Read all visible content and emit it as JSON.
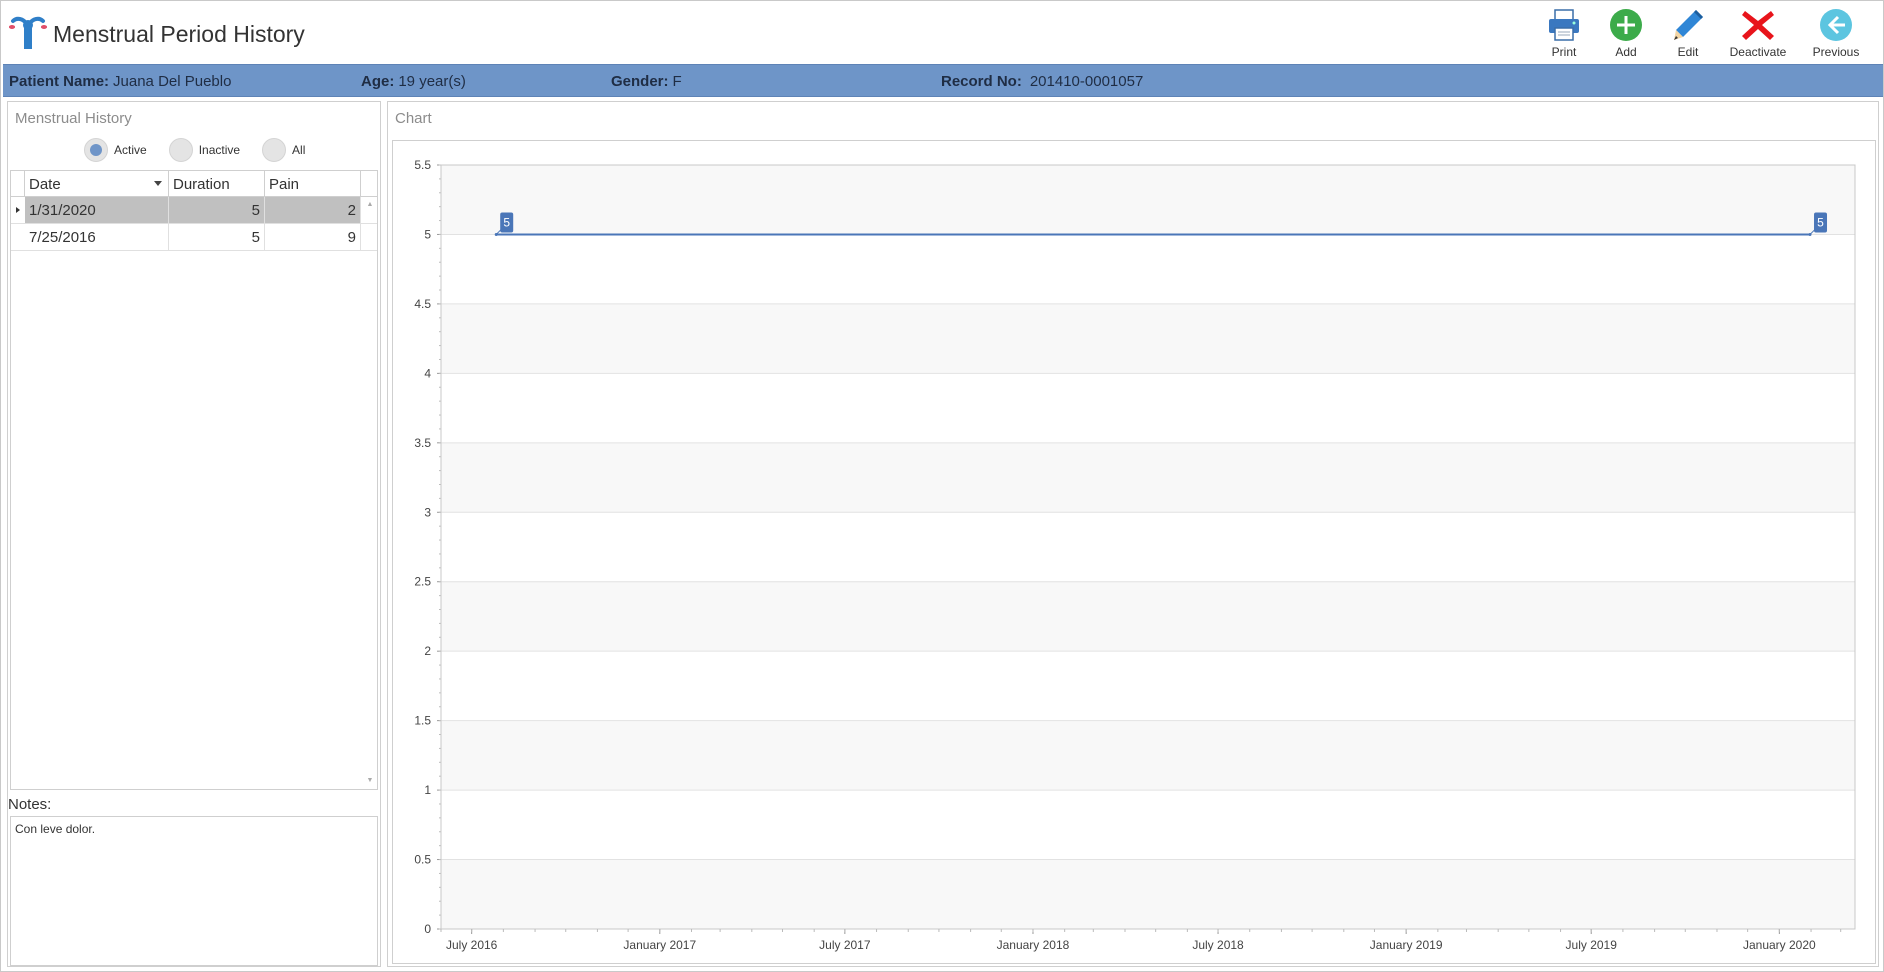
{
  "header": {
    "title": "Menstrual Period History",
    "logo_icon": "uterus-icon"
  },
  "toolbar": {
    "print_label": "Print",
    "add_label": "Add",
    "edit_label": "Edit",
    "deactivate_label": "Deactivate",
    "previous_label": "Previous"
  },
  "patient": {
    "name_label": "Patient Name:",
    "name": "Juana Del Pueblo",
    "age_label": "Age:",
    "age": "19 year(s)",
    "gender_label": "Gender:",
    "gender": "F",
    "record_label": "Record No:",
    "record": "201410-0001057"
  },
  "history": {
    "title": "Menstrual History",
    "filters": [
      {
        "label": "Active",
        "selected": true
      },
      {
        "label": "Inactive",
        "selected": false
      },
      {
        "label": "All",
        "selected": false
      }
    ],
    "columns": [
      "Date",
      "Duration",
      "Pain"
    ],
    "rows": [
      {
        "date": "1/31/2020",
        "duration": "5",
        "pain": "2",
        "selected": true
      },
      {
        "date": "7/25/2016",
        "duration": "5",
        "pain": "9",
        "selected": false
      }
    ]
  },
  "notes": {
    "label": "Notes:",
    "text": "Con leve dolor."
  },
  "chart_panel": {
    "title": "Chart"
  },
  "chart_data": {
    "type": "line",
    "x": [
      "2016-07-25",
      "2020-01-31"
    ],
    "series": [
      {
        "values": [
          5,
          5
        ],
        "data_labels": [
          "5",
          "5"
        ],
        "color": "#4a76b8"
      }
    ],
    "xlim": [
      "2016-06-01",
      "2020-03-15"
    ],
    "ylim": [
      0,
      5.5
    ],
    "y_ticks": [
      0,
      0.5,
      1,
      1.5,
      2,
      2.5,
      3,
      3.5,
      4,
      4.5,
      5,
      5.5
    ],
    "x_ticks": [
      {
        "date": "2016-07-01",
        "label": "July 2016"
      },
      {
        "date": "2017-01-01",
        "label": "January 2017"
      },
      {
        "date": "2017-07-01",
        "label": "July 2017"
      },
      {
        "date": "2018-01-01",
        "label": "January 2018"
      },
      {
        "date": "2018-07-01",
        "label": "July 2018"
      },
      {
        "date": "2019-01-01",
        "label": "January 2019"
      },
      {
        "date": "2019-07-01",
        "label": "July 2019"
      },
      {
        "date": "2020-01-01",
        "label": "January 2020"
      }
    ],
    "grid": true,
    "legend": "none",
    "title": "",
    "xlabel": "",
    "ylabel": ""
  }
}
